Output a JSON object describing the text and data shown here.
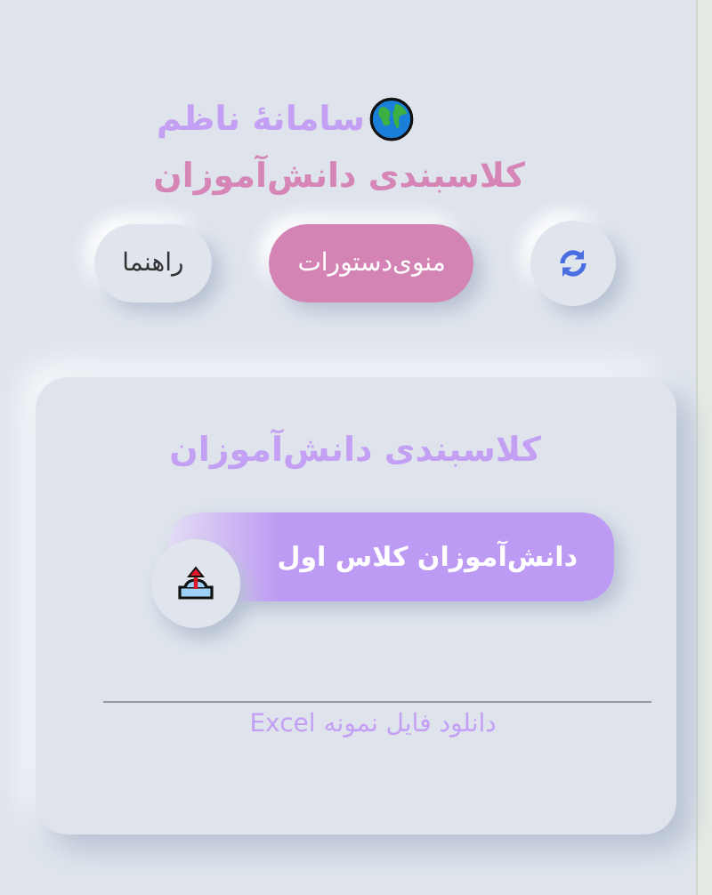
{
  "header": {
    "title": "سامانهٔ ناظم",
    "subtitle": "کلاسبندی دانش‌آموزان"
  },
  "toolbar": [
    {
      "kind": "refresh"
    },
    {
      "kind": "primary",
      "label": "منوی‌دستورات"
    },
    {
      "kind": "plain",
      "label": "راهنما"
    }
  ],
  "card": {
    "title": "کلاسبندی دانش‌آموزان",
    "upload_button": "دانش‌آموزان کلاس اول",
    "download_link": "دانلود فایل نمونه Excel"
  }
}
